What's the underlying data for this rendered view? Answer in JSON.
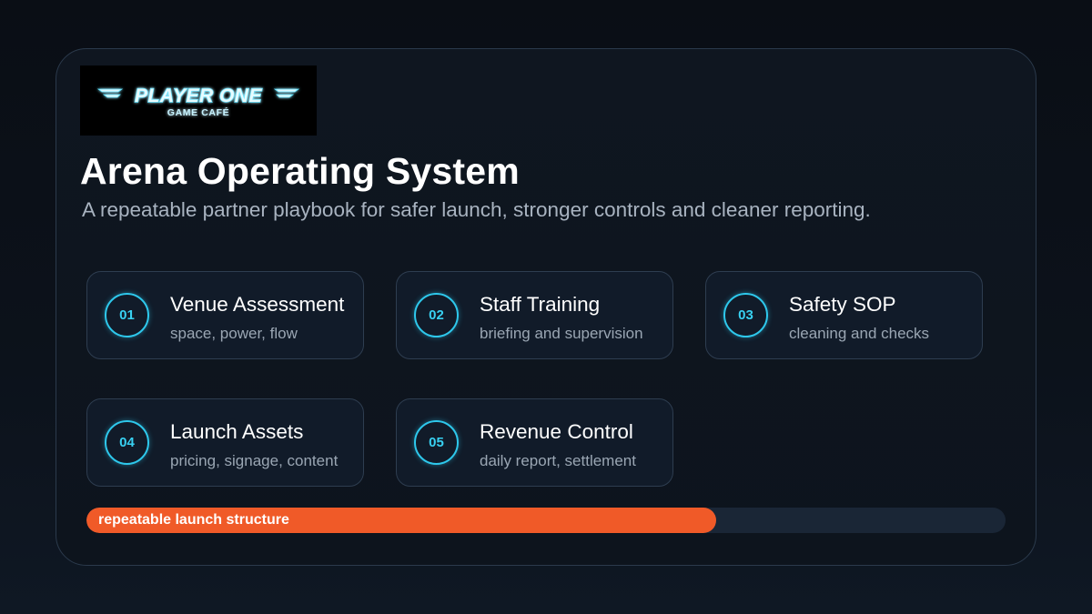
{
  "logo": {
    "primary": "PLAYER ONE",
    "secondary": "GAME CAFÉ",
    "glow_color": "#5fe3ff"
  },
  "title": "Arena Operating System",
  "subtitle": "A repeatable partner playbook for safer launch, stronger controls and cleaner reporting.",
  "steps": [
    {
      "number": "01",
      "title": "Venue Assessment",
      "detail": "space, power, flow"
    },
    {
      "number": "02",
      "title": "Staff Training",
      "detail": "briefing and supervision"
    },
    {
      "number": "03",
      "title": "Safety SOP",
      "detail": "cleaning and checks"
    },
    {
      "number": "04",
      "title": "Launch Assets",
      "detail": "pricing, signage, content"
    },
    {
      "number": "05",
      "title": "Revenue Control",
      "detail": "daily report, settlement"
    }
  ],
  "progress": {
    "label": "repeatable launch structure",
    "fraction": 0.685
  },
  "colors": {
    "accent": "#f05a28",
    "badge": "#2ec8ec",
    "card_border": "#2e3d50",
    "track": "#1a2636"
  }
}
